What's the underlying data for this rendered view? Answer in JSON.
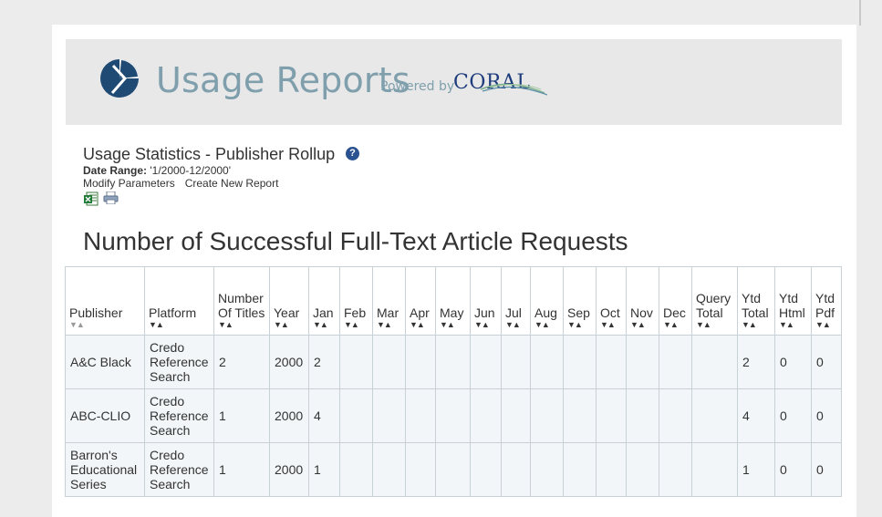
{
  "header": {
    "app_title": "Usage Reports",
    "powered_by": "Powered by",
    "brand": "CORAL"
  },
  "report": {
    "title": "Usage Statistics - Publisher Rollup",
    "help_glyph": "?",
    "date_range_label": "Date Range:",
    "date_range_value": " '1/2000-12/2000'",
    "modify_parameters": "Modify Parameters",
    "create_new_report": "Create New Report",
    "section_title": "Number of Successful Full-Text Article Requests"
  },
  "icons": {
    "excel": "excel-export-icon",
    "print": "print-icon"
  },
  "colors": {
    "accent": "#7f9fad",
    "brand_blue": "#1d3c7c",
    "help_blue": "#2a5290",
    "row_bg": "#f2f6f8",
    "border": "#c7d1d6"
  },
  "table": {
    "columns": [
      {
        "label": "Publisher"
      },
      {
        "label": "Platform"
      },
      {
        "label": "Number Of Titles"
      },
      {
        "label": "Year"
      },
      {
        "label": "Jan"
      },
      {
        "label": "Feb"
      },
      {
        "label": "Mar"
      },
      {
        "label": "Apr"
      },
      {
        "label": "May"
      },
      {
        "label": "Jun"
      },
      {
        "label": "Jul"
      },
      {
        "label": "Aug"
      },
      {
        "label": "Sep"
      },
      {
        "label": "Oct"
      },
      {
        "label": "Nov"
      },
      {
        "label": "Dec"
      },
      {
        "label": "Query Total"
      },
      {
        "label": "Ytd Total"
      },
      {
        "label": "Ytd Html"
      },
      {
        "label": "Ytd Pdf"
      }
    ],
    "sort_glyph": "▼▲",
    "rows": [
      [
        "A&C Black",
        "Credo Reference Search",
        "2",
        "2000",
        "2",
        "",
        "",
        "",
        "",
        "",
        "",
        "",
        "",
        "",
        "",
        "",
        "",
        "2",
        "0",
        "0"
      ],
      [
        "ABC-CLIO",
        "Credo Reference Search",
        "1",
        "2000",
        "4",
        "",
        "",
        "",
        "",
        "",
        "",
        "",
        "",
        "",
        "",
        "",
        "",
        "4",
        "0",
        "0"
      ],
      [
        "Barron's Educational Series",
        "Credo Reference Search",
        "1",
        "2000",
        "1",
        "",
        "",
        "",
        "",
        "",
        "",
        "",
        "",
        "",
        "",
        "",
        "",
        "1",
        "0",
        "0"
      ]
    ]
  }
}
